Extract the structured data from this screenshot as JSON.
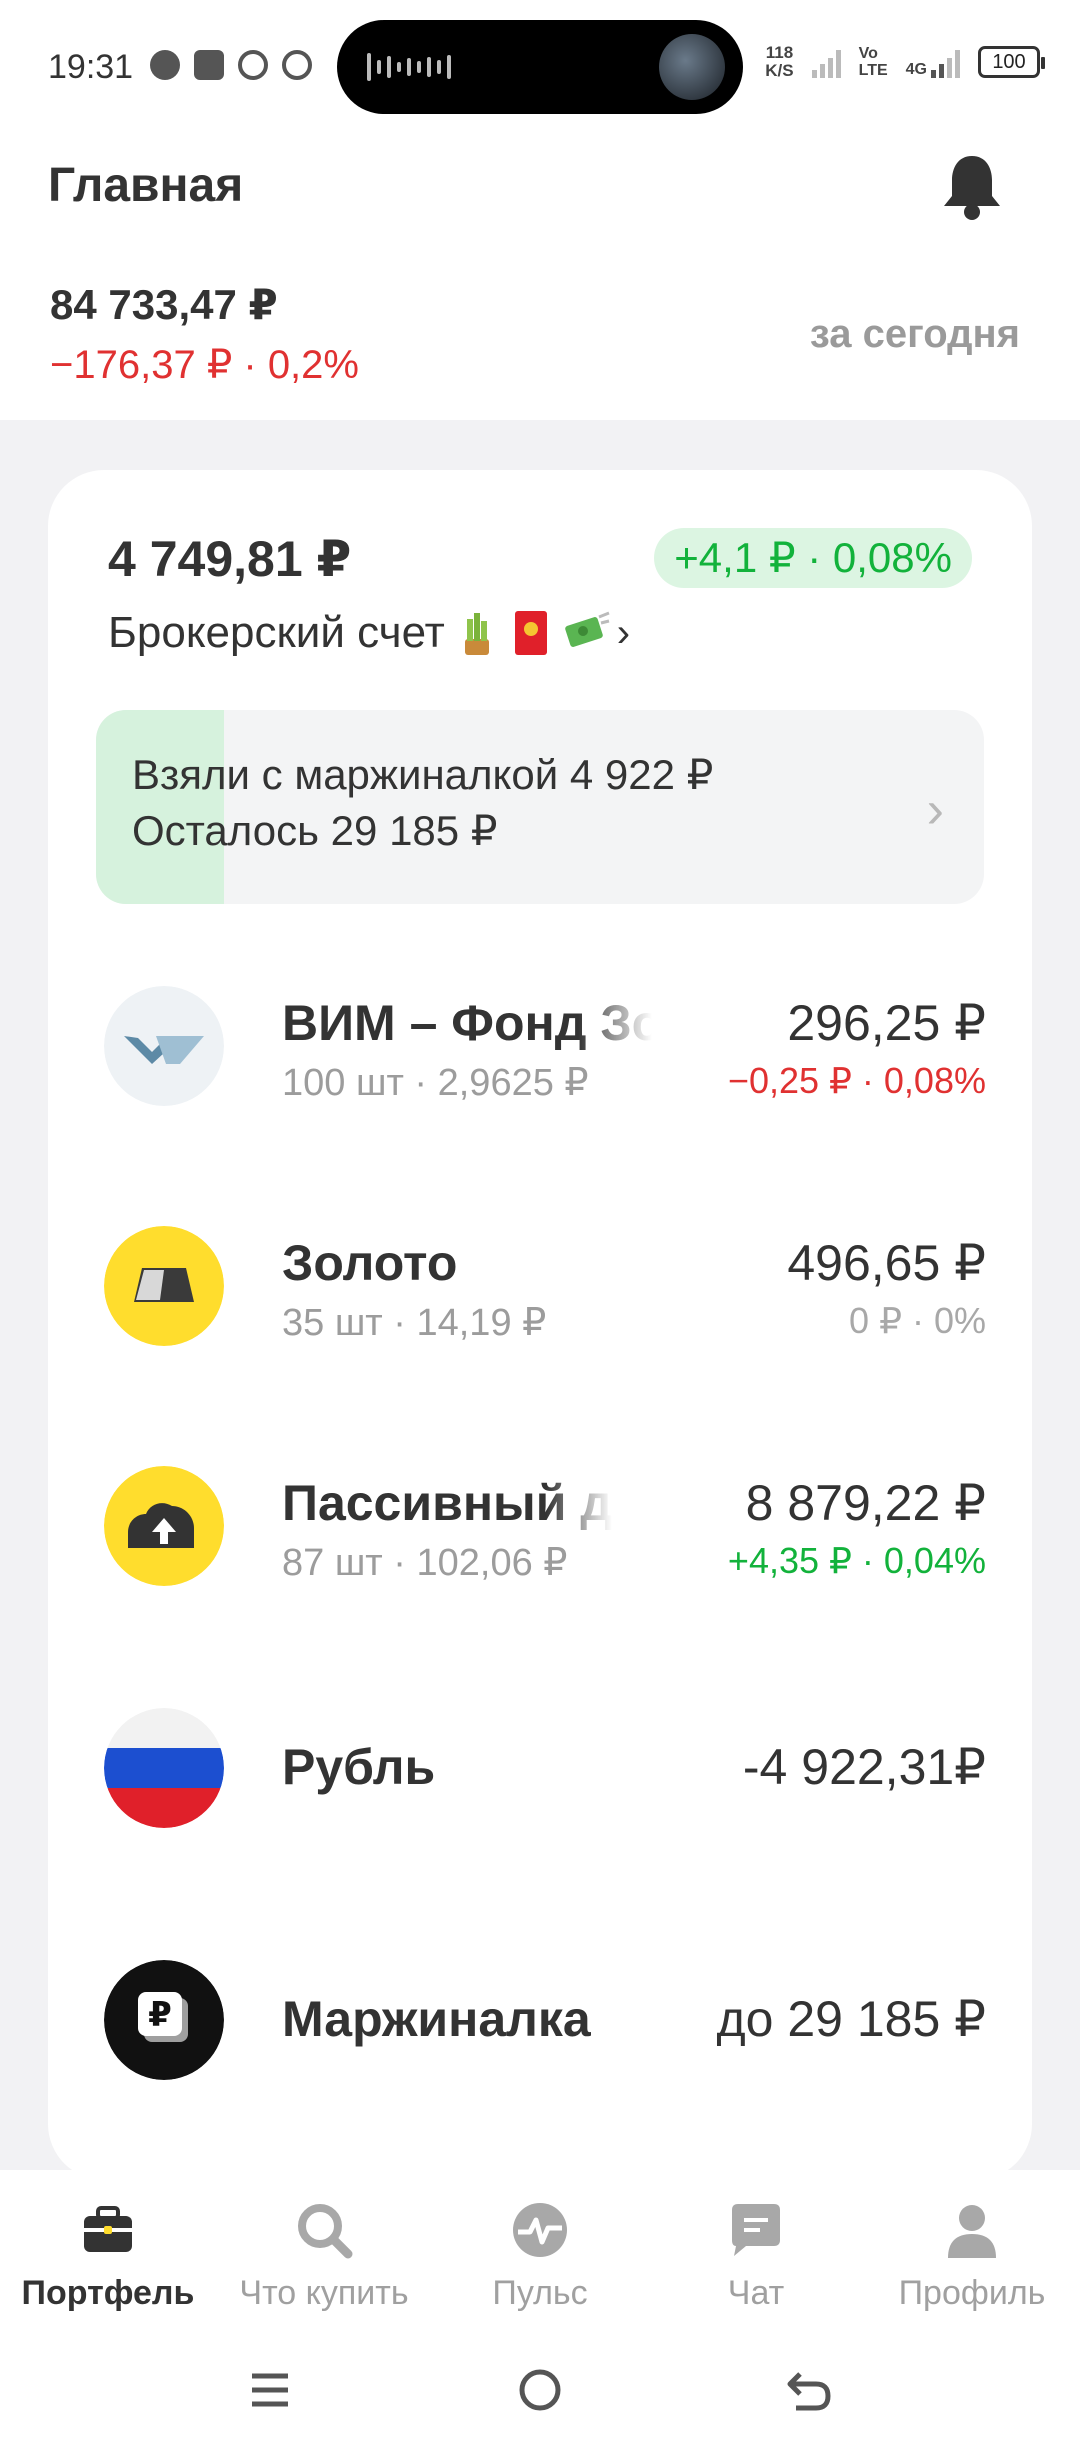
{
  "status_bar": {
    "time": "19:31",
    "netspeed_value": "118",
    "netspeed_unit": "K/S",
    "volte_top": "Vo",
    "volte_bottom": "LTE",
    "network": "4G",
    "battery": "100"
  },
  "header": {
    "title": "Главная",
    "total_value": "84 733,47  ₽",
    "total_change": "−176,37 ₽ · 0,2%",
    "period": "за сегодня"
  },
  "account": {
    "value": "4 749,81 ₽",
    "change": "+4,1 ₽ · 0,08%",
    "name": "Брокерский счет",
    "chevron": "›",
    "margin_banner": {
      "line1": "Взяли с маржиналкой 4 922 ₽",
      "line2": "Осталось 29 185 ₽",
      "used_fraction": 0.144,
      "chevron": "›"
    }
  },
  "assets": [
    {
      "name": "ВИМ – Фонд Золото",
      "sub": "100 шт · 2,9625 ₽",
      "value": "296,25 ₽",
      "change": "−0,25 ₽ · 0,08%",
      "change_color": "#e03131",
      "icon": "vim-fund-icon"
    },
    {
      "name": "Золото",
      "sub": "35 шт · 14,19 ₽",
      "value": "496,65 ₽",
      "change": "0 ₽ · 0%",
      "change_color": "#a8a8a8",
      "icon": "gold-bar-icon"
    },
    {
      "name": "Пассивный доход",
      "sub": "87 шт · 102,06 ₽",
      "value": "8 879,22 ₽",
      "change": "+4,35 ₽ · 0,04%",
      "change_color": "#12b23b",
      "icon": "passive-income-icon"
    },
    {
      "name": "Рубль",
      "value": "-4 922,31₽",
      "icon": "russia-flag-icon"
    },
    {
      "name": "Маржиналка",
      "value": "до 29 185 ₽",
      "icon": "margin-ruble-icon"
    }
  ],
  "nav": {
    "items": [
      {
        "label": "Портфель",
        "active": true,
        "icon": "briefcase-icon"
      },
      {
        "label": "Что купить",
        "active": false,
        "icon": "search-icon"
      },
      {
        "label": "Пульс",
        "active": false,
        "icon": "pulse-icon"
      },
      {
        "label": "Чат",
        "active": false,
        "icon": "chat-icon"
      },
      {
        "label": "Профиль",
        "active": false,
        "icon": "profile-icon"
      }
    ]
  },
  "colors": {
    "negative": "#e03131",
    "positive": "#12b23b",
    "accent_yellow": "#ffdd2d",
    "muted": "#9c9c9c"
  }
}
